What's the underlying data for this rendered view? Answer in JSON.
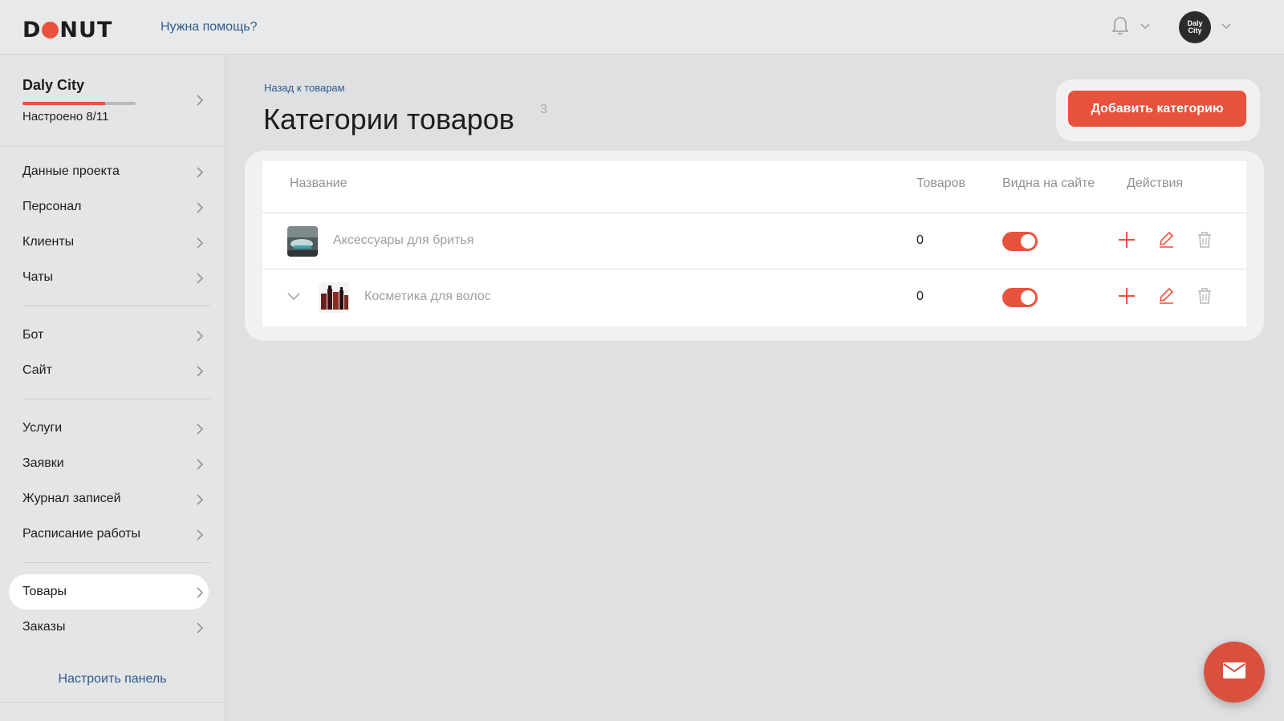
{
  "header": {
    "logo_text_left": "D",
    "logo_text_right": "NUT",
    "help_link": "Нужна помощь?",
    "avatar_line1": "Daly",
    "avatar_line2": "City"
  },
  "sidebar": {
    "project_name": "Daly City",
    "project_status": "Настроено 8/11",
    "progress_fraction": 0.727,
    "groups": [
      [
        "Данные проекта",
        "Персонал",
        "Клиенты",
        "Чаты"
      ],
      [
        "Бот",
        "Сайт"
      ],
      [
        "Услуги",
        "Заявки",
        "Журнал записей",
        "Расписание работы"
      ],
      [
        "Товары",
        "Заказы"
      ]
    ],
    "active_item": "Товары",
    "configure_link": "Настроить панель"
  },
  "main": {
    "back_link": "Назад к товарам",
    "title": "Категории товаров",
    "title_count": "3",
    "add_button": "Добавить категорию",
    "table": {
      "headers": {
        "name": "Название",
        "count": "Товаров",
        "visible": "Видна на сайте",
        "actions": "Действия"
      },
      "rows": [
        {
          "name": "Аксессуары для бритья",
          "count": "0",
          "visible": true,
          "expandable": false
        },
        {
          "name": "Косметика для волос",
          "count": "0",
          "visible": true,
          "expandable": true
        }
      ]
    }
  },
  "colors": {
    "accent": "#e8523d",
    "link": "#2d5b8f",
    "background": "#dfe0e2"
  },
  "icons": {
    "bell": "bell-icon",
    "chevron": "chevron-right-icon",
    "add": "plus-icon",
    "edit": "pencil-icon",
    "delete": "trash-icon",
    "mail": "mail-icon"
  }
}
